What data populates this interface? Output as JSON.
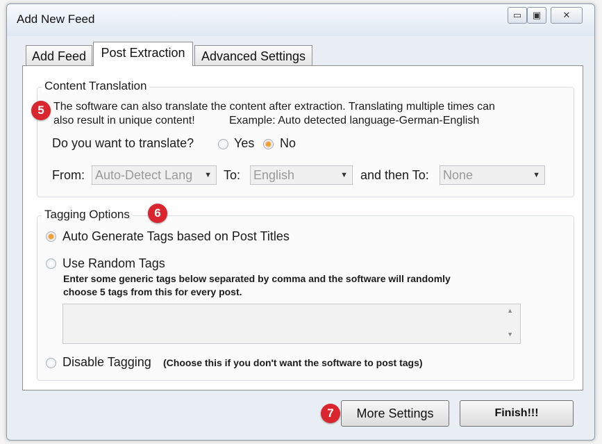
{
  "window": {
    "title": "Add New Feed",
    "min_glyph": "▭",
    "max_glyph": "▣",
    "close_glyph": "✕"
  },
  "tabs": [
    {
      "label": "Add Feed"
    },
    {
      "label": "Post Extraction"
    },
    {
      "label": "Advanced Settings"
    }
  ],
  "translation": {
    "legend": "Content Translation",
    "badge": "5",
    "desc_line1": "The software can also translate the content after extraction. Translating multiple times can",
    "desc_line2": "also result in unique content!",
    "example": "Example: Auto detected language-German-English",
    "question": "Do you want to translate?",
    "yes_label": "Yes",
    "no_label": "No",
    "selected": "No",
    "from_label": "From:",
    "from_value": "Auto-Detect Lang",
    "to_label": "To:",
    "to_value": "English",
    "then_label": "and then To:",
    "then_value": "None"
  },
  "tagging": {
    "legend": "Tagging Options",
    "badge": "6",
    "option_auto": "Auto Generate Tags based on Post Titles",
    "option_random": "Use Random Tags",
    "random_desc1": "Enter some generic tags below separated by comma and the software will randomly",
    "random_desc2": "choose 5 tags from this for every post.",
    "tags_value": "",
    "option_disable": "Disable Tagging",
    "disable_note": "(Choose this if you don't want the software to post tags)",
    "selected": "Auto Generate Tags based on Post Titles"
  },
  "footer": {
    "badge": "7",
    "more_settings_label": "More Settings",
    "finish_label": "Finish!!!"
  },
  "colors": {
    "badge": "#d9262e",
    "radio_selected": "#f0a030"
  }
}
